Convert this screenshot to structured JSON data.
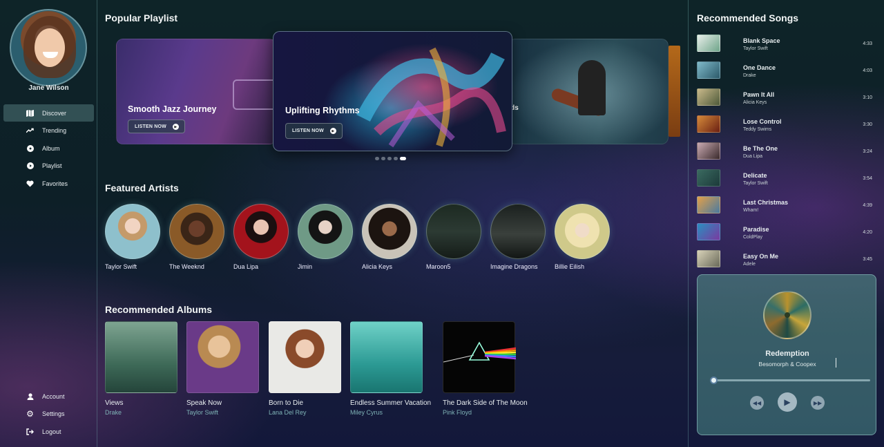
{
  "user": {
    "name": "Jane Wilson"
  },
  "nav": {
    "items": [
      {
        "label": "Discover",
        "icon": "map-icon",
        "glyph": "▮▮"
      },
      {
        "label": "Trending",
        "icon": "trending-icon",
        "glyph": "↗"
      },
      {
        "label": "Album",
        "icon": "album-icon",
        "glyph": "◉"
      },
      {
        "label": "Playlist",
        "icon": "playlist-icon",
        "glyph": "▶"
      },
      {
        "label": "Favorites",
        "icon": "heart-icon",
        "glyph": "♥"
      }
    ],
    "bottom": [
      {
        "label": "Account",
        "icon": "user-icon",
        "glyph": "👤"
      },
      {
        "label": "Settings",
        "icon": "gear-icon",
        "glyph": "⚙"
      },
      {
        "label": "Logout",
        "icon": "logout-icon",
        "glyph": "⇥"
      }
    ]
  },
  "popular": {
    "title": "Popular Playlist",
    "slides": [
      {
        "title": "Smooth Jazz Journey",
        "button": "LISTEN NOW"
      },
      {
        "title": "Uplifting Rhythms",
        "button": "LISTEN NOW"
      },
      {
        "title": "ods"
      }
    ],
    "active_dot": 4,
    "dot_count": 5
  },
  "artists": {
    "title": "Featured Artists",
    "items": [
      "Taylor Swift",
      "The Weeknd",
      "Dua Lipa",
      "Jimin",
      "Alicia Keys",
      "Maroon5",
      "Imagine Dragons",
      "Billie Eilish"
    ]
  },
  "albums": {
    "title": "Recommended Albums",
    "items": [
      {
        "title": "Views",
        "artist": "Drake"
      },
      {
        "title": "Speak Now",
        "artist": "Taylor Swift"
      },
      {
        "title": "Born to Die",
        "artist": "Lana Del Rey"
      },
      {
        "title": "Endless Summer Vacation",
        "artist": "Miley Cyrus"
      },
      {
        "title": "The Dark Side of The Moon",
        "artist": "Pink Floyd"
      }
    ]
  },
  "recommended": {
    "title": "Recommended Songs",
    "songs": [
      {
        "title": "Blank Space",
        "artist": "Taylor Swift",
        "duration": "4:33"
      },
      {
        "title": "One Dance",
        "artist": "Drake",
        "duration": "4:03"
      },
      {
        "title": "Pawn It All",
        "artist": "Alicia Keys",
        "duration": "3:10"
      },
      {
        "title": "Lose Control",
        "artist": "Teddy Swims",
        "duration": "3:30"
      },
      {
        "title": "Be The One",
        "artist": "Dua Lipa",
        "duration": "3:24"
      },
      {
        "title": "Delicate",
        "artist": "Taylor Swift",
        "duration": "3:54"
      },
      {
        "title": "Last Christmas",
        "artist": "Wham!",
        "duration": "4:39"
      },
      {
        "title": "Paradise",
        "artist": "ColdPlay",
        "duration": "4:20"
      },
      {
        "title": "Easy On Me",
        "artist": "Adele",
        "duration": "3:45"
      }
    ]
  },
  "player": {
    "title": "Redemption",
    "artist": "Besomorph & Coopex",
    "progress": 0.02
  }
}
